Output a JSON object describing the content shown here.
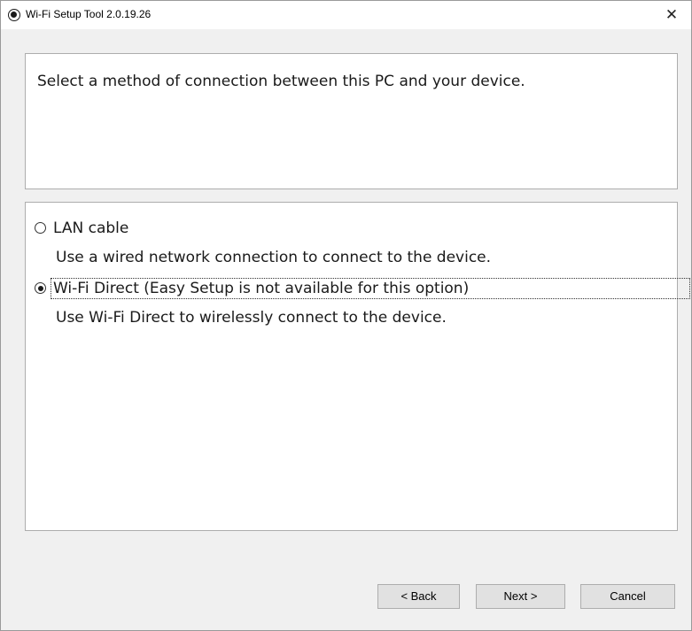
{
  "window": {
    "title": "Wi-Fi Setup Tool 2.0.19.26",
    "app_icon": "radio-target-icon",
    "close_glyph": "✕"
  },
  "header": {
    "instruction": "Select a method of connection between this PC and your device."
  },
  "options": [
    {
      "label": "LAN cable",
      "description": "Use a wired network connection to connect to the device.",
      "selected": false
    },
    {
      "label": "Wi-Fi Direct (Easy Setup is not available for this option)",
      "description": "Use Wi-Fi Direct to wirelessly connect to the device.",
      "selected": true
    }
  ],
  "buttons": {
    "back": "< Back",
    "next": "Next >",
    "cancel": "Cancel"
  }
}
